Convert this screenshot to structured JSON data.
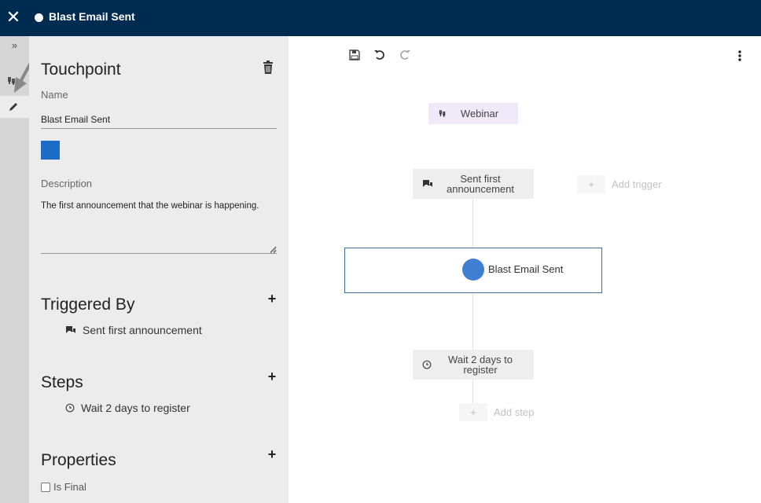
{
  "header": {
    "title": "Blast Email Sent",
    "close_icon": "close-icon"
  },
  "rail": {
    "expand_glyph": "»",
    "items": [
      "trigger-icon",
      "pencil-icon"
    ]
  },
  "panel": {
    "heading": "Touchpoint",
    "name_label": "Name",
    "name_value": "Blast Email Sent",
    "color": "#1c6bc8",
    "description_label": "Description",
    "description_value": "The first announcement that the webinar is happening.",
    "triggered_by": {
      "heading": "Triggered By",
      "items": [
        "Sent first announcement"
      ]
    },
    "steps": {
      "heading": "Steps",
      "items": [
        "Wait 2 days to register"
      ]
    },
    "properties": {
      "heading": "Properties",
      "is_final_label": "Is Final",
      "is_final_checked": false
    }
  },
  "canvas": {
    "toolbar": [
      "save-icon",
      "undo-icon",
      "redo-icon"
    ],
    "root": "Webinar",
    "trigger_node": "Sent first announcement",
    "add_trigger": "Add trigger",
    "selected_node": "Blast Email Sent",
    "step_node": "Wait 2 days to register",
    "add_step": "Add step",
    "accent_color": "#3f7fd2"
  }
}
